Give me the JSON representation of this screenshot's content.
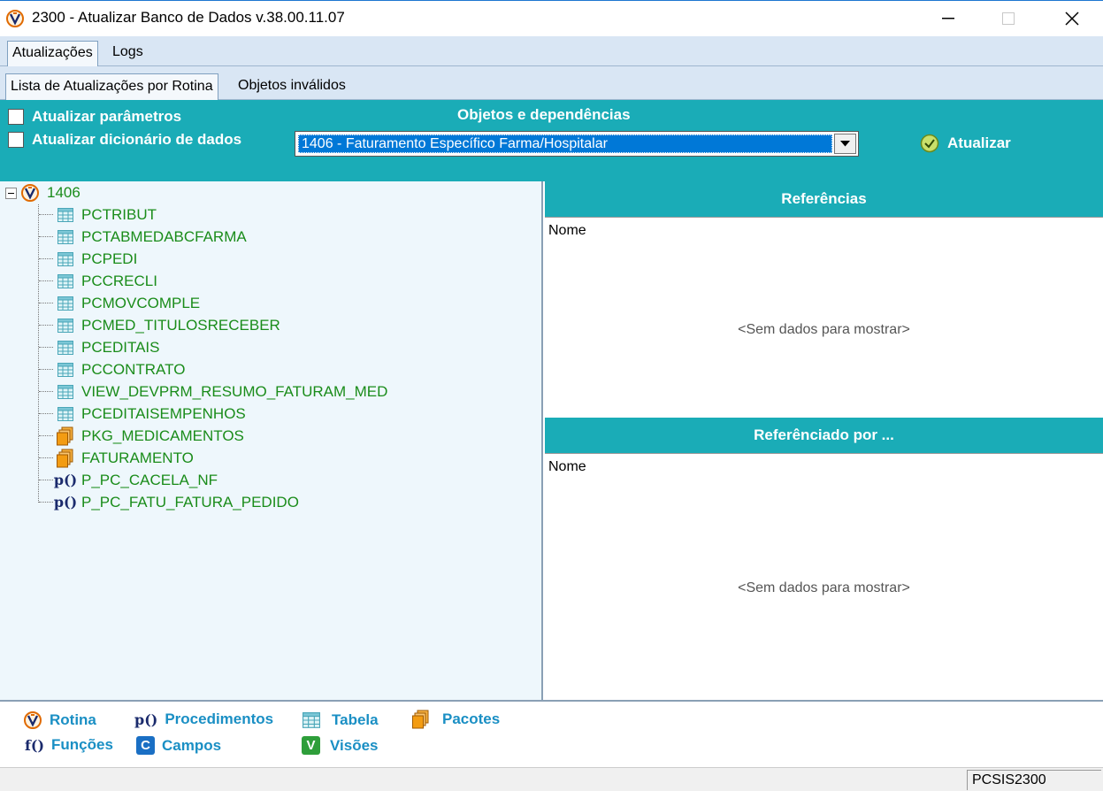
{
  "window": {
    "title": "2300 - Atualizar Banco de Dados v.38.00.11.07"
  },
  "tabs_outer": [
    {
      "label": "Atualizações",
      "active": true
    },
    {
      "label": "Logs",
      "active": false
    }
  ],
  "tabs_inner": [
    {
      "label": "Lista de Atualizações por Rotina",
      "active": true
    },
    {
      "label": "Objetos inválidos",
      "active": false
    }
  ],
  "toolbar": {
    "check_params": "Atualizar parâmetros",
    "check_dict": "Atualizar dicionário de dados",
    "objects_title": "Objetos e dependências",
    "combo_value": "1406 - Faturamento Específico Farma/Hospitalar",
    "update_label": "Atualizar"
  },
  "tree": {
    "root": "1406",
    "items": [
      {
        "label": "PCTRIBUT",
        "icon": "table-icon"
      },
      {
        "label": "PCTABMEDABCFARMA",
        "icon": "table-icon"
      },
      {
        "label": "PCPEDI",
        "icon": "table-icon"
      },
      {
        "label": "PCCRECLI",
        "icon": "table-icon"
      },
      {
        "label": "PCMOVCOMPLE",
        "icon": "table-icon"
      },
      {
        "label": "PCMED_TITULOSRECEBER",
        "icon": "table-icon"
      },
      {
        "label": "PCEDITAIS",
        "icon": "table-icon"
      },
      {
        "label": "PCCONTRATO",
        "icon": "table-icon"
      },
      {
        "label": "VIEW_DEVPRM_RESUMO_FATURAM_MED",
        "icon": "table-icon"
      },
      {
        "label": "PCEDITAISEMPENHOS",
        "icon": "table-icon"
      },
      {
        "label": "PKG_MEDICAMENTOS",
        "icon": "package-icon"
      },
      {
        "label": "FATURAMENTO",
        "icon": "package-icon"
      },
      {
        "label": "P_PC_CACELA_NF",
        "icon": "procedure-icon"
      },
      {
        "label": "P_PC_FATU_FATURA_PEDIDO",
        "icon": "procedure-icon"
      }
    ]
  },
  "references": {
    "title": "Referências",
    "column": "Nome",
    "empty": "<Sem dados para mostrar>"
  },
  "referenced_by": {
    "title": "Referênciado por ...",
    "column": "Nome",
    "empty": "<Sem dados para mostrar>"
  },
  "legend": {
    "rotina": "Rotina",
    "procedimentos": "Procedimentos",
    "tabela": "Tabela",
    "pacotes": "Pacotes",
    "funcoes": "Funções",
    "campos": "Campos",
    "visoes": "Visões",
    "proc_glyph": "p()",
    "func_glyph": "f()",
    "campos_glyph": "C",
    "visoes_glyph": "V"
  },
  "status": {
    "module": "PCSIS2300"
  },
  "colors": {
    "teal": "#1aacb7",
    "tree_text": "#1a8c1a",
    "legend_text": "#1a8fc4"
  }
}
